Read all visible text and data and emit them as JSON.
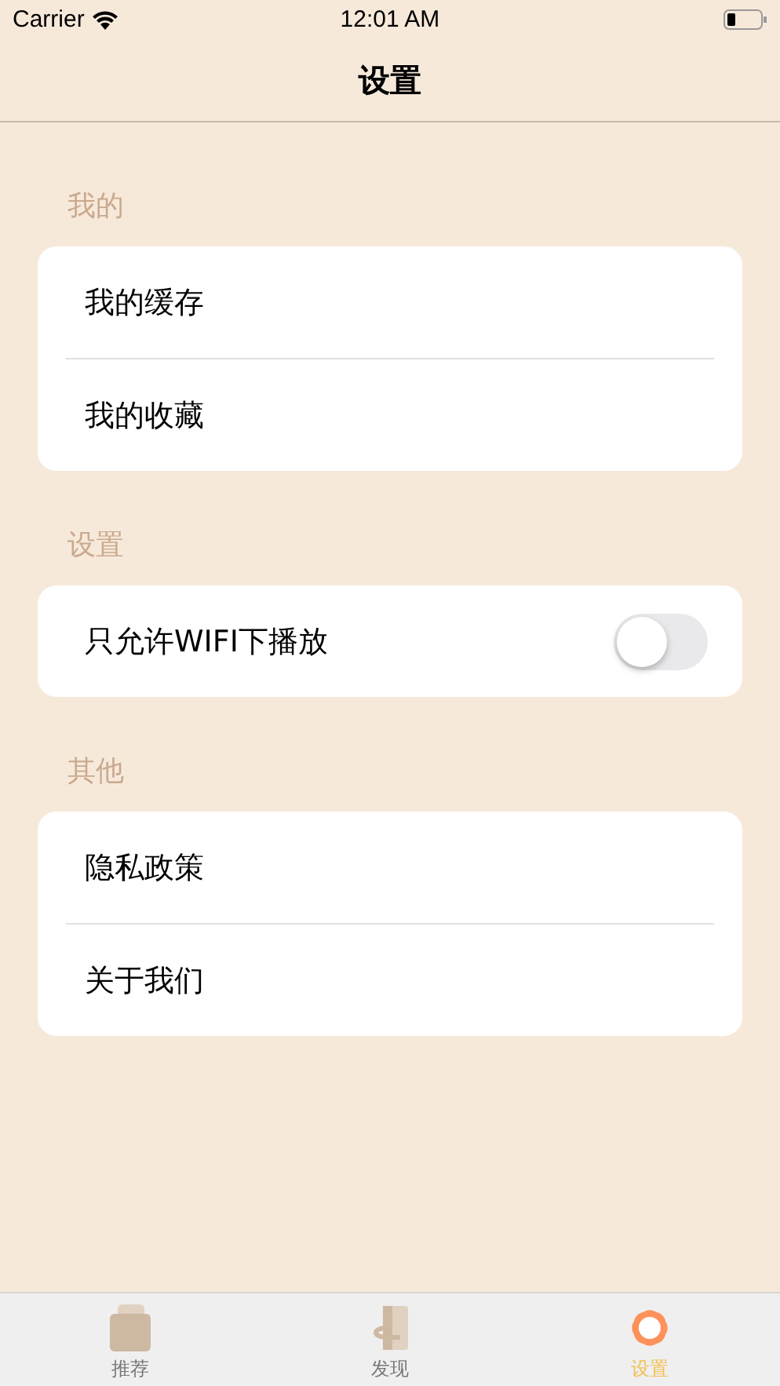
{
  "status_bar": {
    "carrier": "Carrier",
    "time": "12:01 AM"
  },
  "nav": {
    "title": "设置"
  },
  "sections": [
    {
      "title": "我的",
      "rows": [
        {
          "kind": "link",
          "label": "我的缓存"
        },
        {
          "kind": "link",
          "label": "我的收藏"
        }
      ]
    },
    {
      "title": "设置",
      "rows": [
        {
          "kind": "toggle",
          "label": "只允许WIFI下播放",
          "on": false
        }
      ]
    },
    {
      "title": "其他",
      "rows": [
        {
          "kind": "link",
          "label": "隐私政策"
        },
        {
          "kind": "link",
          "label": "关于我们"
        }
      ]
    }
  ],
  "tabs": [
    {
      "label": "推荐",
      "selected": false,
      "kind": "cards"
    },
    {
      "label": "发现",
      "selected": false,
      "kind": "door"
    },
    {
      "label": "设置",
      "selected": true,
      "kind": "gear"
    }
  ]
}
